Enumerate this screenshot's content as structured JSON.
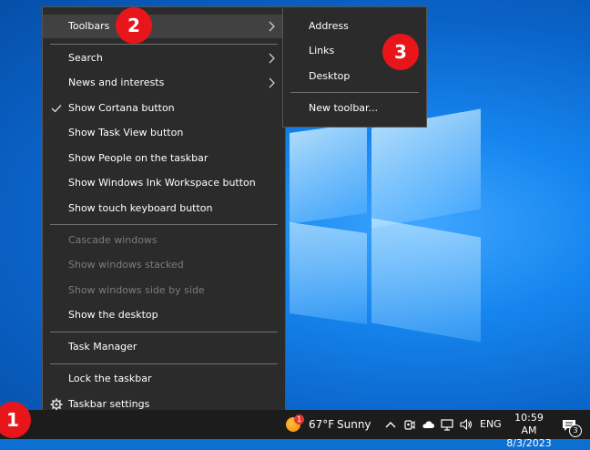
{
  "context_menu": {
    "items": [
      {
        "label": "Toolbars"
      },
      {
        "label": "Search"
      },
      {
        "label": "News and interests"
      },
      {
        "label": "Show Cortana button"
      },
      {
        "label": "Show Task View button"
      },
      {
        "label": "Show People on the taskbar"
      },
      {
        "label": "Show Windows Ink Workspace button"
      },
      {
        "label": "Show touch keyboard button"
      },
      {
        "label": "Cascade windows"
      },
      {
        "label": "Show windows stacked"
      },
      {
        "label": "Show windows side by side"
      },
      {
        "label": "Show the desktop"
      },
      {
        "label": "Task Manager"
      },
      {
        "label": "Lock the taskbar"
      },
      {
        "label": "Taskbar settings"
      }
    ]
  },
  "toolbars_submenu": {
    "items": [
      {
        "label": "Address"
      },
      {
        "label": "Links"
      },
      {
        "label": "Desktop"
      },
      {
        "label": "New toolbar..."
      }
    ]
  },
  "step_badges": [
    "1",
    "2",
    "3"
  ],
  "taskbar": {
    "weather_temp": "67°F",
    "weather_condition": "Sunny",
    "weather_badge": "1",
    "language": "ENG",
    "time": "10:59 AM",
    "date": "8/3/2023",
    "notification_count": "3"
  },
  "colors": {
    "menu_bg": "#2b2b2b",
    "badge_red": "#e8151b",
    "taskbar_bg": "#1c1c1c"
  }
}
